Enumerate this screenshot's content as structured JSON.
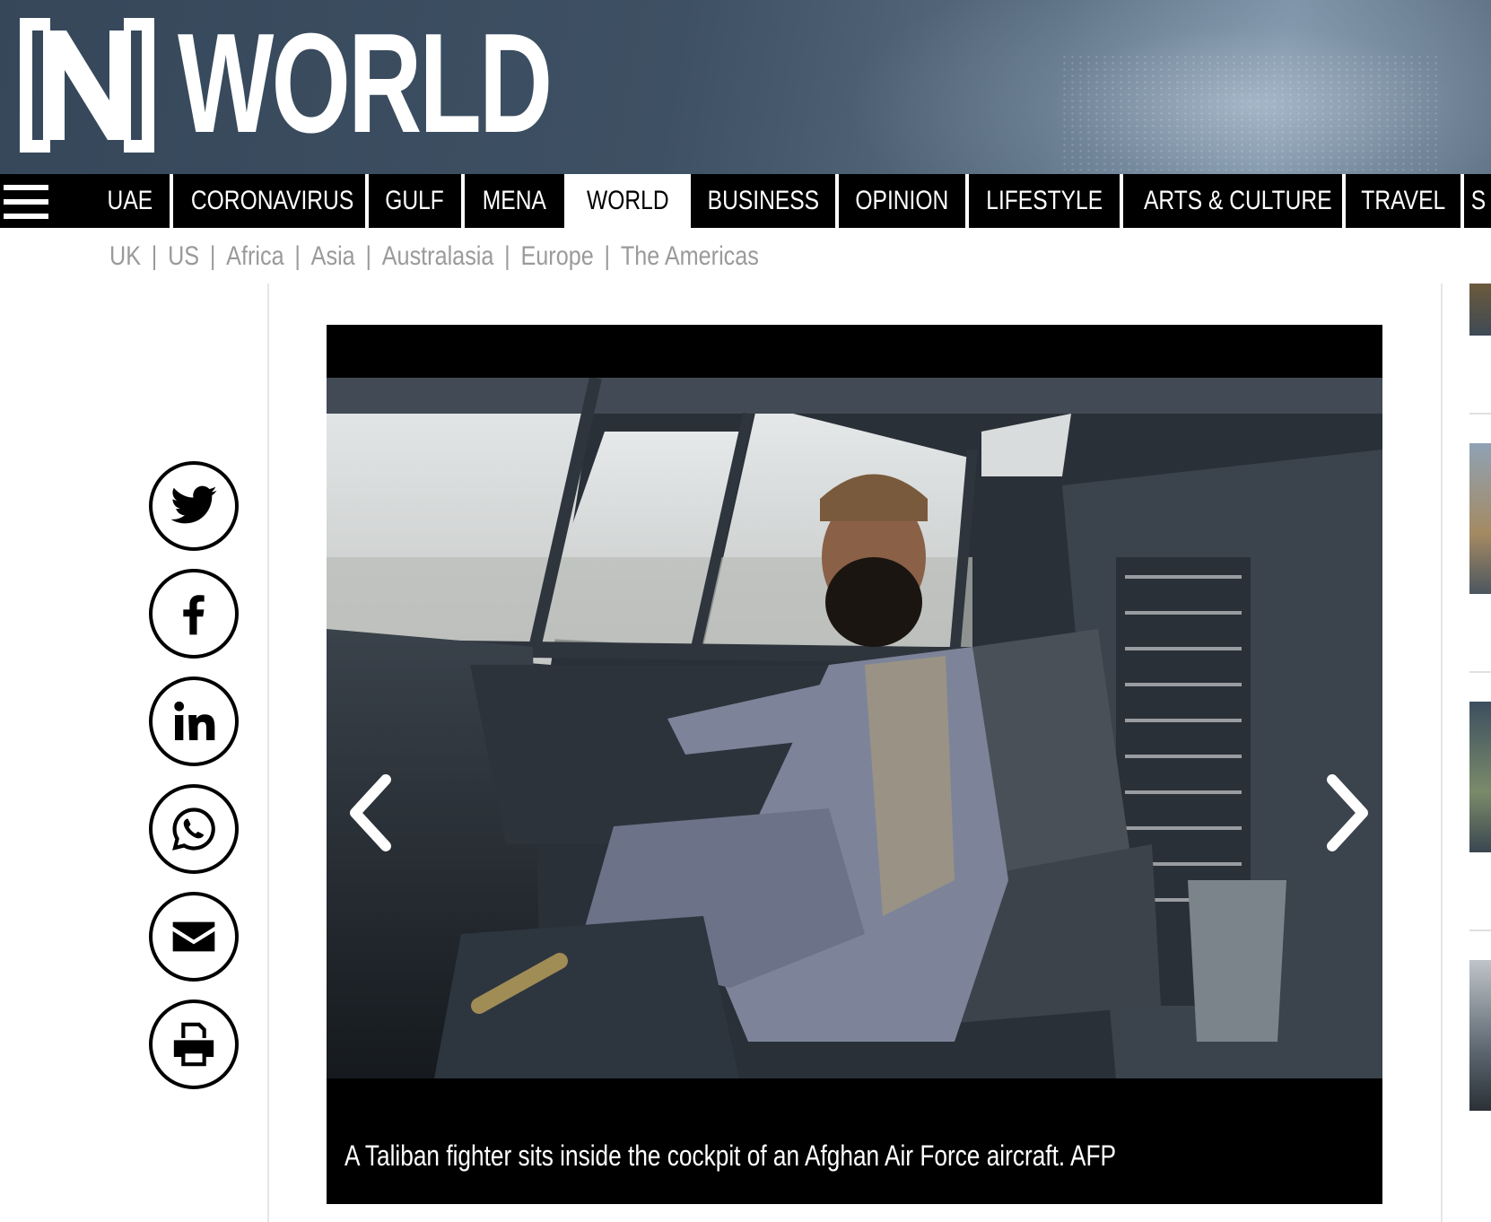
{
  "brand": {
    "word": "WORLD",
    "logo": "N-bracket-logo"
  },
  "nav": {
    "items": [
      {
        "label": "UAE",
        "active": false
      },
      {
        "label": "CORONAVIRUS",
        "active": false
      },
      {
        "label": "GULF",
        "active": false
      },
      {
        "label": "MENA",
        "active": false
      },
      {
        "label": "WORLD",
        "active": true
      },
      {
        "label": "BUSINESS",
        "active": false
      },
      {
        "label": "OPINION",
        "active": false
      },
      {
        "label": "LIFESTYLE",
        "active": false
      },
      {
        "label": "ARTS & CULTURE",
        "active": false
      },
      {
        "label": "TRAVEL",
        "active": false
      },
      {
        "label": "S",
        "active": false
      }
    ],
    "menu_icon": "hamburger-icon"
  },
  "subnav": {
    "items": [
      "UK",
      "US",
      "Africa",
      "Asia",
      "Australasia",
      "Europe",
      "The Americas"
    ],
    "separator": "|"
  },
  "share": {
    "icons": [
      "twitter-icon",
      "facebook-icon",
      "linkedin-icon",
      "whatsapp-icon",
      "email-icon",
      "print-icon"
    ]
  },
  "gallery": {
    "caption": "A Taliban fighter sits inside the cockpit of an Afghan Air Force aircraft. AFP",
    "prev_icon": "chevron-left-icon",
    "next_icon": "chevron-right-icon"
  },
  "colors": {
    "banner": "#3e5063",
    "nav_bg": "#000000",
    "active_bg": "#ffffff",
    "subnav_text": "#9a9a9a"
  }
}
